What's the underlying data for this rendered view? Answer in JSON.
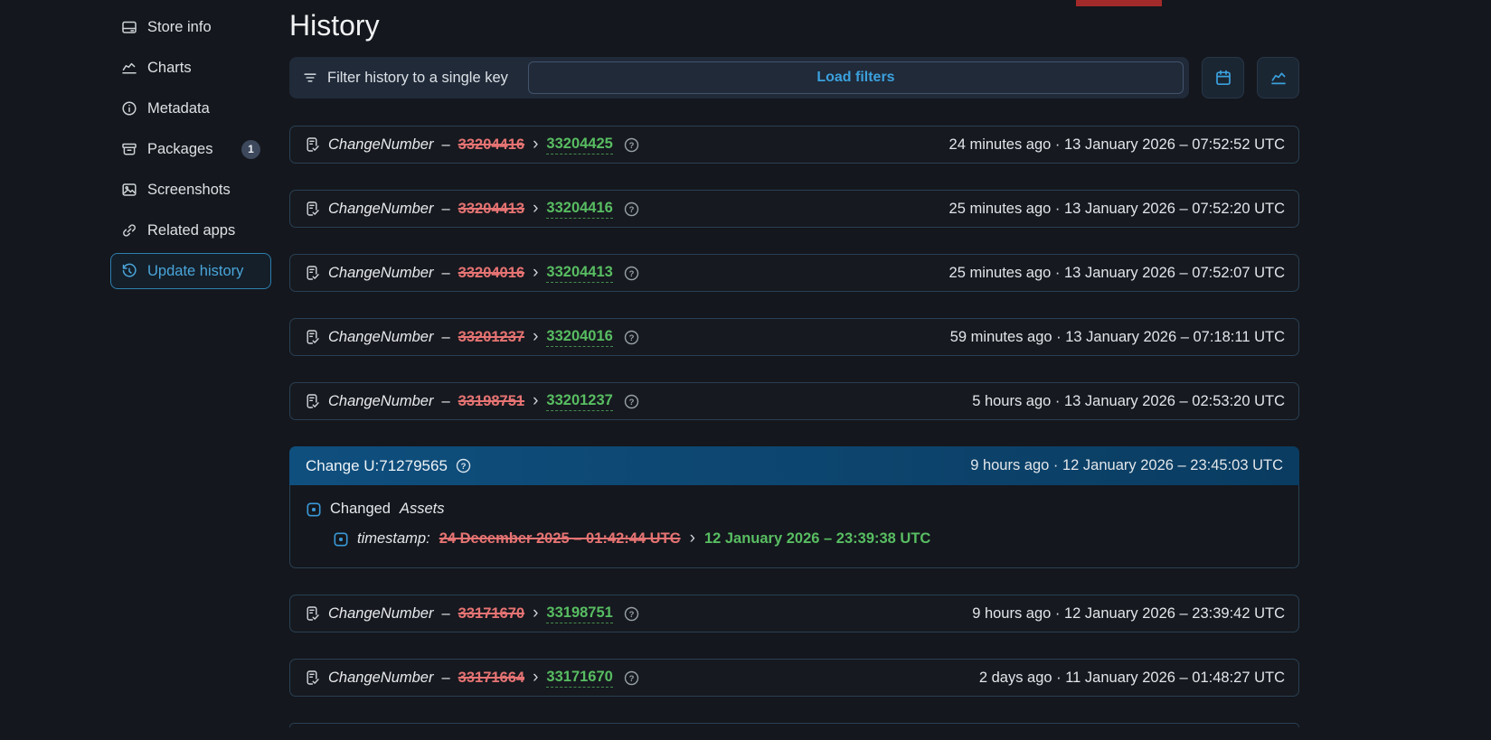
{
  "header": {
    "title": "History"
  },
  "sidebar": {
    "items": [
      {
        "label": "Store info"
      },
      {
        "label": "Charts"
      },
      {
        "label": "Metadata"
      },
      {
        "label": "Packages",
        "badge": "1"
      },
      {
        "label": "Screenshots"
      },
      {
        "label": "Related apps"
      },
      {
        "label": "Update history"
      }
    ]
  },
  "filter_bar": {
    "label": "Filter history to a single key",
    "select_label": "Load filters"
  },
  "glyphs": {
    "dash": "–",
    "arrow": "›",
    "help": "?"
  },
  "history": {
    "rows": [
      {
        "field": "ChangeNumber",
        "old": "33204416",
        "new": "33204425",
        "when": "24 minutes ago · 13 January 2026 – 07:52:52 UTC"
      },
      {
        "field": "ChangeNumber",
        "old": "33204413",
        "new": "33204416",
        "when": "25 minutes ago · 13 January 2026 – 07:52:20 UTC"
      },
      {
        "field": "ChangeNumber",
        "old": "33204016",
        "new": "33204413",
        "when": "25 minutes ago · 13 January 2026 – 07:52:07 UTC"
      },
      {
        "field": "ChangeNumber",
        "old": "33201237",
        "new": "33204016",
        "when": "59 minutes ago · 13 January 2026 – 07:18:11 UTC"
      },
      {
        "field": "ChangeNumber",
        "old": "33198751",
        "new": "33201237",
        "when": "5 hours ago · 13 January 2026 – 02:53:20 UTC"
      },
      {
        "field": "ChangeNumber",
        "old": "33171670",
        "new": "33198751",
        "when": "9 hours ago · 12 January 2026 – 23:39:42 UTC"
      },
      {
        "field": "ChangeNumber",
        "old": "33171664",
        "new": "33171670",
        "when": "2 days ago · 11 January 2026 – 01:48:27 UTC"
      }
    ],
    "group": {
      "title": "Change U:71279565",
      "when": "9 hours ago · 12 January 2026 – 23:45:03 UTC",
      "changed_label": "Changed",
      "changed_field": "Assets",
      "item_field": "timestamp:",
      "old": "24 December 2025 – 01:42:44 UTC",
      "new": "12 January 2026 – 23:39:38 UTC"
    }
  },
  "colors": {
    "accent_blue": "#3ba1dd",
    "removed_red": "#e57373",
    "added_green": "#58bd62",
    "group_header_blue": "#0d4a75"
  }
}
